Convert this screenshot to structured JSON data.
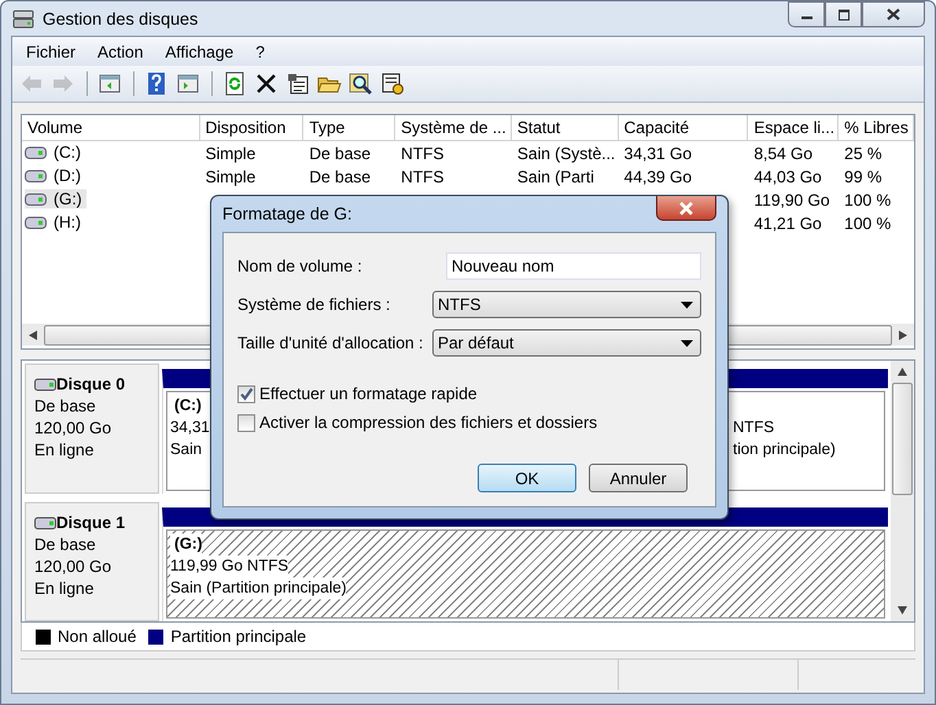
{
  "window": {
    "title": "Gestion des disques"
  },
  "menu": [
    "Fichier",
    "Action",
    "Affichage",
    "?"
  ],
  "toolbar": [
    {
      "kind": "back",
      "disabled": true
    },
    {
      "kind": "forward",
      "disabled": true
    },
    {
      "kind": "separator"
    },
    {
      "kind": "tree",
      "disabled": false
    },
    {
      "kind": "separator"
    },
    {
      "kind": "help",
      "disabled": false
    },
    {
      "kind": "pane",
      "disabled": false
    },
    {
      "kind": "separator"
    },
    {
      "kind": "refresh",
      "disabled": false
    },
    {
      "kind": "delete",
      "disabled": false
    },
    {
      "kind": "properties",
      "disabled": false
    },
    {
      "kind": "open",
      "disabled": false
    },
    {
      "kind": "search",
      "disabled": false
    },
    {
      "kind": "settings",
      "disabled": false
    }
  ],
  "table": {
    "columns": [
      "Volume",
      "Disposition",
      "Type",
      "Système de ...",
      "Statut",
      "Capacité",
      "Espace li...",
      "% Libres"
    ],
    "rows": [
      {
        "selected": false,
        "cells": [
          "(C:)",
          "Simple",
          "De base",
          "NTFS",
          "Sain (Systè...",
          "34,31 Go",
          "8,54 Go",
          "25 %"
        ]
      },
      {
        "selected": false,
        "cells": [
          "(D:)",
          "Simple",
          "De base",
          "NTFS",
          "Sain (Parti",
          "44,39 Go",
          "44,03 Go",
          "99 %"
        ]
      },
      {
        "selected": true,
        "cells": [
          "(G:)",
          null,
          null,
          null,
          null,
          null,
          "119,90 Go",
          "100 %"
        ]
      },
      {
        "selected": false,
        "cells": [
          "(H:)",
          null,
          null,
          null,
          null,
          null,
          "41,21 Go",
          "100 %"
        ]
      }
    ]
  },
  "disks": [
    {
      "name": "Disque 0",
      "type": "De base",
      "size": "120,00 Go",
      "status": "En ligne",
      "partitions": [
        {
          "selected": false,
          "lines": [
            "(C:)",
            "34,31",
            "Sain"
          ]
        },
        {
          "selected": false,
          "lines": [
            "NTFS",
            "tion principale)"
          ]
        }
      ]
    },
    {
      "name": "Disque 1",
      "type": "De base",
      "size": "120,00 Go",
      "status": "En ligne",
      "partitions": [
        {
          "selected": true,
          "lines": [
            "(G:)",
            "119,99 Go NTFS",
            "Sain (Partition principale)"
          ]
        }
      ]
    }
  ],
  "legend": [
    {
      "label": "Non alloué",
      "color": "#000000"
    },
    {
      "label": "Partition principale",
      "color": "#000080"
    }
  ],
  "dialog": {
    "title": "Formatage de G:",
    "fields": [
      {
        "kind": "text",
        "label": "Nom de volume :",
        "value": "Nouveau nom"
      },
      {
        "kind": "select",
        "label": "Système de fichiers :",
        "value": "NTFS"
      },
      {
        "kind": "select",
        "label": "Taille d'unité d'allocation :",
        "value": "Par défaut"
      }
    ],
    "checkboxes": [
      {
        "label": "Effectuer un formatage rapide",
        "checked": true
      },
      {
        "label": "Activer la compression des fichiers et dossiers",
        "checked": false
      }
    ],
    "buttons": [
      {
        "label": "OK",
        "default": true
      },
      {
        "label": "Annuler",
        "default": false
      }
    ]
  }
}
